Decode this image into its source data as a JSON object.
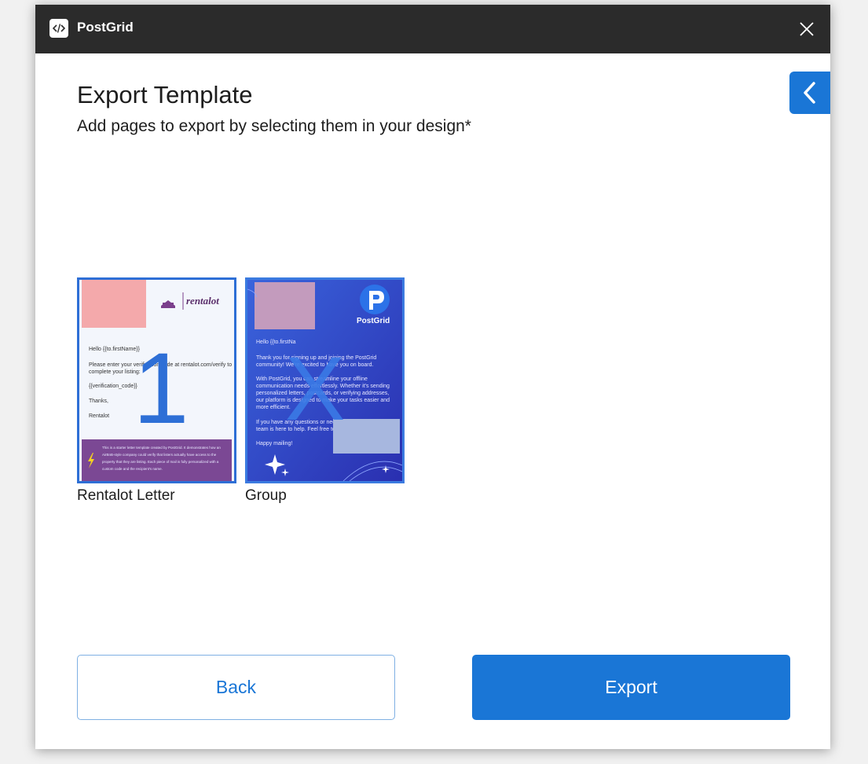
{
  "app": {
    "name": "PostGrid",
    "logo_icon": "code-brackets-icon"
  },
  "dialog": {
    "title": "Export Template",
    "subtitle": "Add pages to export by selecting them in your design*"
  },
  "pages": [
    {
      "label": "Rentalot Letter",
      "badge": "1",
      "preview": {
        "brand": "rentalot",
        "greeting": "Hello {{to.firstName}}",
        "body1": "Please enter your verification code at rentalot.com/verify to",
        "body2": "complete your listing:",
        "code": "{{verification_code}}",
        "thanks": "Thanks,",
        "sign": "Rentalot",
        "footer1": "This is a starter letter template created by PostGrid. It demonstrates how an",
        "footer2": "AirBnB-style company could verify that listers actually have access to the",
        "footer3": "property that they are listing. Each piece of mail is fully personalized with a",
        "footer4": "custom code and the recipient's name."
      }
    },
    {
      "label": "Group",
      "badge": "X",
      "preview": {
        "brand": "PostGrid",
        "greeting": "Hello {{to.firstNa",
        "p1a": "Thank you for signing up and joining the PostGrid",
        "p1b": "community! We're excited to have you on board.",
        "p2a": "With PostGrid, you can streamline your offline",
        "p2b": "communication needs effortlessly. Whether it's sending",
        "p2c": "personalized letters, postcards, or verifying addresses,",
        "p2d": "our platform is designed to make your tasks easier and",
        "p2e": "more efficient.",
        "p3a": "If you have any questions or need",
        "p3b": "team is here to help. Feel free to",
        "closing": "Happy mailing!"
      }
    }
  ],
  "buttons": {
    "back": "Back",
    "export": "Export"
  },
  "colors": {
    "accent": "#1a76d6",
    "titlebar": "#2b2b2b",
    "selection": "#2e6fd6"
  }
}
